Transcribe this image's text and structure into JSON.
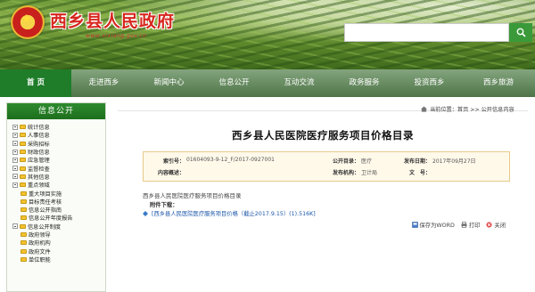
{
  "header": {
    "site_title": "西乡县人民政府",
    "site_url": "www.xixiang.gov.cn",
    "search_placeholder": ""
  },
  "nav": {
    "items": [
      "首 页",
      "走进西乡",
      "新闻中心",
      "信息公开",
      "互动交流",
      "政务服务",
      "投资西乡",
      "西乡旅游"
    ],
    "active_index": 0
  },
  "sidebar": {
    "title": "信息公开",
    "items": [
      {
        "label": "统计信息",
        "child": false
      },
      {
        "label": "人事信息",
        "child": false
      },
      {
        "label": "采购招标",
        "child": false
      },
      {
        "label": "财政信息",
        "child": false
      },
      {
        "label": "应急管理",
        "child": false
      },
      {
        "label": "监督检查",
        "child": false
      },
      {
        "label": "其他信息",
        "child": false
      },
      {
        "label": "重点领域",
        "child": false
      },
      {
        "label": "重大项目实施",
        "child": true
      },
      {
        "label": "目标责任考核",
        "child": true
      },
      {
        "label": "信息公开指南",
        "child": true
      },
      {
        "label": "信息公开年度报告",
        "child": true
      },
      {
        "label": "信息公开制度",
        "child": false
      },
      {
        "label": "政府领导",
        "child": true
      },
      {
        "label": "政府机构",
        "child": true
      },
      {
        "label": "政府文件",
        "child": true
      },
      {
        "label": "单位职能",
        "child": true
      }
    ]
  },
  "breadcrumb": {
    "text": "当前位置：首页 >> 公开信息内容"
  },
  "article": {
    "title": "西乡县人民医院医疗服务项目价格目录",
    "meta": {
      "index_label": "索引号：",
      "index_value": "01604093-9-12_F/2017-0927001",
      "category_label": "公开目录：",
      "category_value": "医疗",
      "date_label": "发布日期：",
      "date_value": "2017年09月27日",
      "summary_label": "内容概述：",
      "summary_value": "",
      "org_label": "发布机构：",
      "org_value": "卫计局",
      "docno_label": "文　号：",
      "docno_value": ""
    },
    "body_text": "西乡县人民医院医疗服务项目价格目录",
    "attachment_label": "附件下载：",
    "attachment_link": "[西乡县人民医院医疗服务项目价格（截止2017.9.15）(1).516K]"
  },
  "tools": {
    "save_word": "保存为WORD",
    "print": "打印",
    "close": "关闭"
  },
  "colors": {
    "brand_red": "#d7261e",
    "nav_active": "#1f7d2a",
    "sidebar_head": "#2e8b2e",
    "link_blue": "#1a56a8",
    "meta_border": "#e6c98a"
  }
}
